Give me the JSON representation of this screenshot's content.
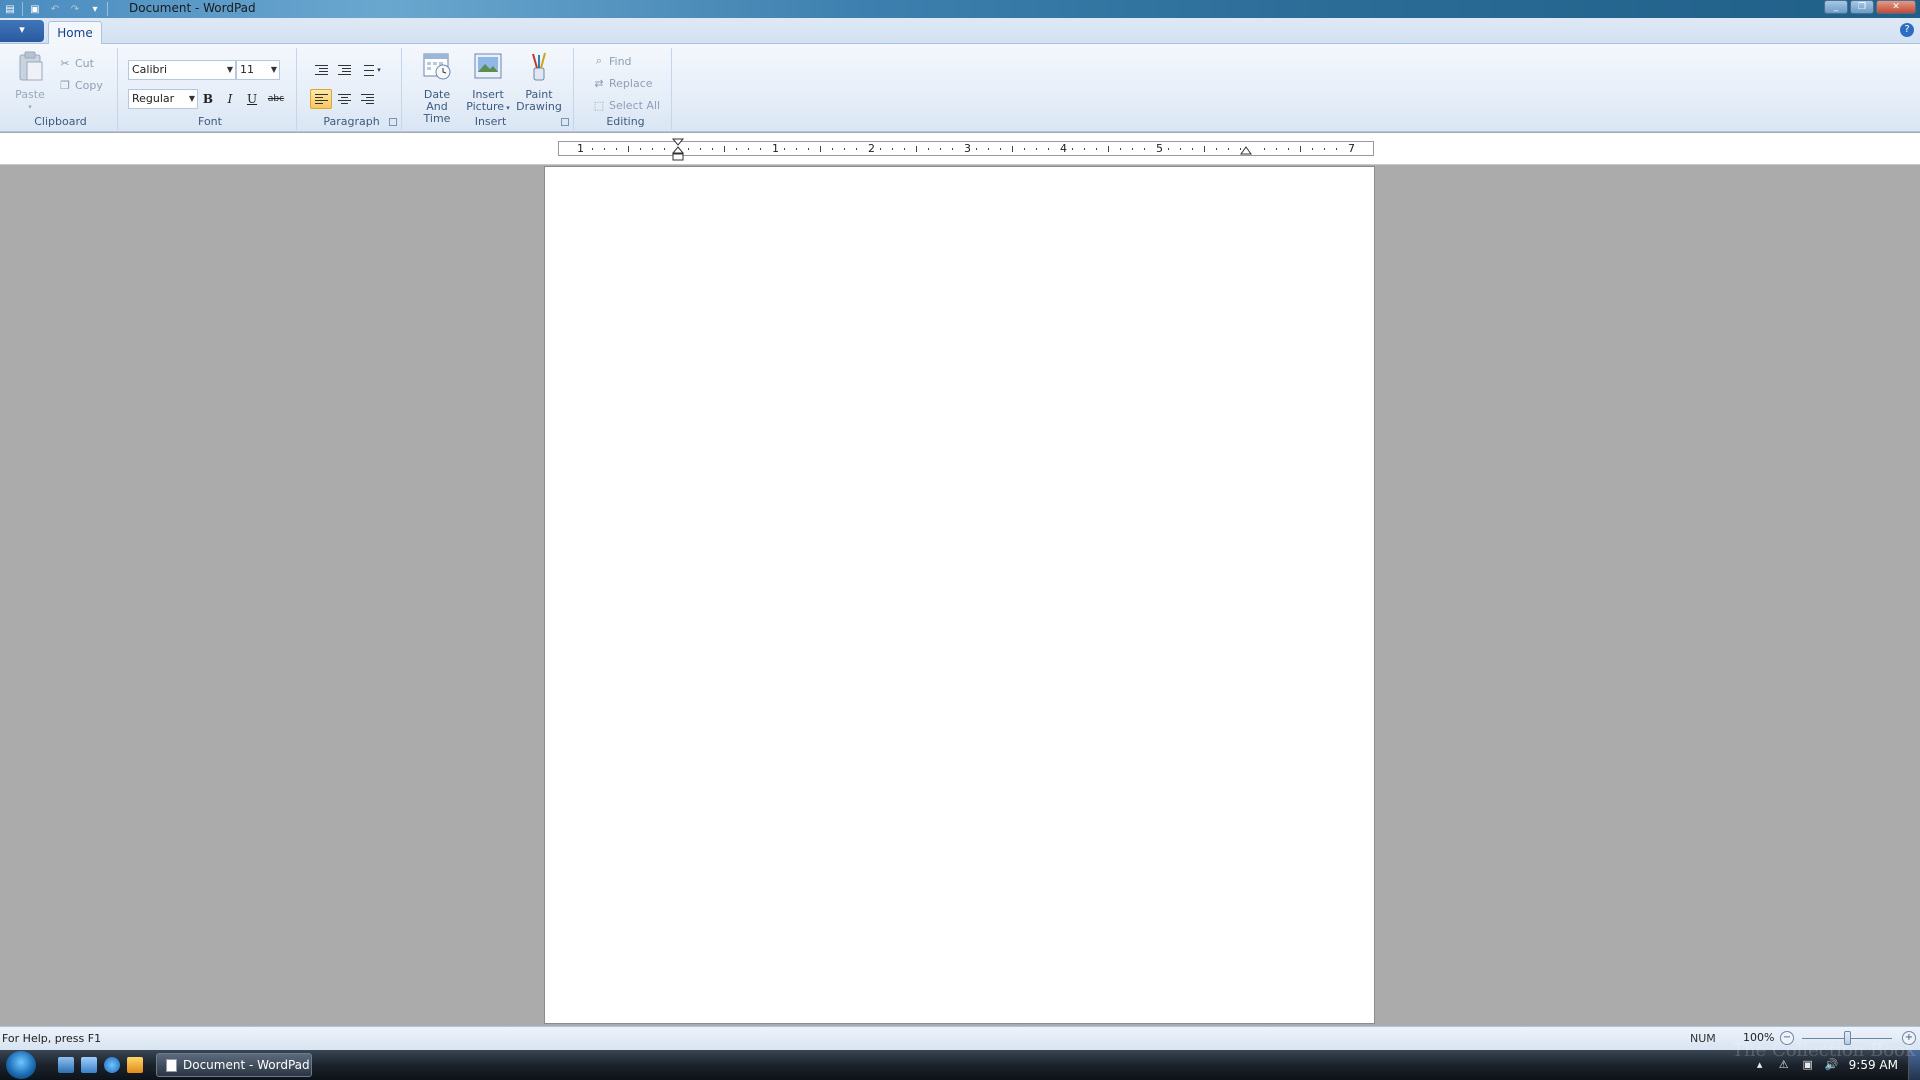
{
  "window": {
    "title": "Document - WordPad"
  },
  "ribbon": {
    "tabs": [
      {
        "label": "Home"
      }
    ],
    "clipboard": {
      "group_label": "Clipboard",
      "paste_label": "Paste",
      "cut_label": "Cut",
      "copy_label": "Copy"
    },
    "font": {
      "group_label": "Font",
      "family_value": "Calibri",
      "size_value": "11",
      "style_value": "Regular",
      "bold_label": "B",
      "italic_label": "I",
      "underline_label": "U",
      "strike_label": "abc"
    },
    "paragraph": {
      "group_label": "Paragraph",
      "active_alignment": "left"
    },
    "insert": {
      "group_label": "Insert",
      "date_time_label_1": "Date And",
      "date_time_label_2": "Time",
      "picture_label_1": "Insert",
      "picture_label_2": "Picture",
      "paint_label_1": "Paint",
      "paint_label_2": "Drawing"
    },
    "editing": {
      "group_label": "Editing",
      "find_label": "Find",
      "replace_label": "Replace",
      "select_all_label": "Select All"
    }
  },
  "ruler": {
    "labels": [
      "1",
      "1",
      "2",
      "3",
      "4",
      "5",
      "7"
    ]
  },
  "status": {
    "help_text": "For Help, press F1",
    "num_indicator": "NUM",
    "zoom_percent": "100%",
    "zoom_level": 1.0
  },
  "taskbar": {
    "active_window_label": "Document - WordPad",
    "clock": "9:59 AM",
    "watermark": "The Collection Book"
  },
  "colors": {
    "accent": "#2a5aa0",
    "ribbon_bg": "#e6eef8",
    "workspace_bg": "#ababab",
    "active_button": "#f8c760"
  }
}
